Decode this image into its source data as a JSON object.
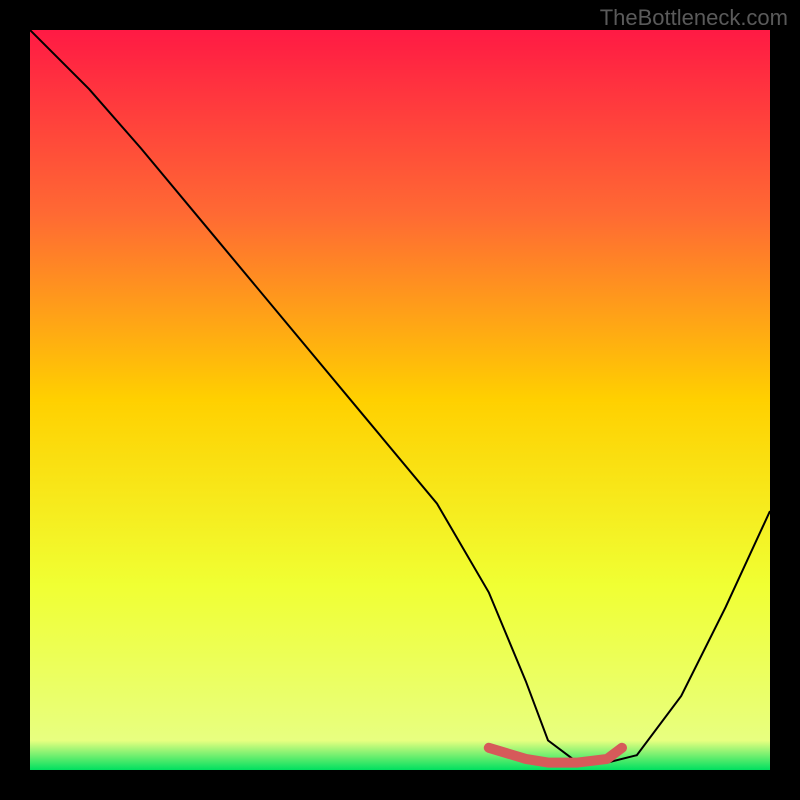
{
  "watermark": "TheBottleneck.com",
  "chart_data": {
    "type": "line",
    "title": "",
    "xlabel": "",
    "ylabel": "",
    "xlim": [
      0,
      100
    ],
    "ylim": [
      0,
      100
    ],
    "gradient_stops": [
      {
        "offset": 0,
        "color": "#ff1a44"
      },
      {
        "offset": 25,
        "color": "#ff6a33"
      },
      {
        "offset": 50,
        "color": "#ffd000"
      },
      {
        "offset": 75,
        "color": "#f0ff33"
      },
      {
        "offset": 96,
        "color": "#e8ff80"
      },
      {
        "offset": 100,
        "color": "#00e060"
      }
    ],
    "series": [
      {
        "name": "bottleneck-curve",
        "color": "#000000",
        "x": [
          0,
          3,
          8,
          15,
          25,
          35,
          45,
          55,
          62,
          67,
          70,
          74,
          78,
          82,
          88,
          94,
          100
        ],
        "y": [
          100,
          97,
          92,
          84,
          72,
          60,
          48,
          36,
          24,
          12,
          4,
          1,
          1,
          2,
          10,
          22,
          35
        ]
      }
    ],
    "highlight": {
      "name": "optimal-zone",
      "color": "#d65a5a",
      "x": [
        62,
        67,
        70,
        74,
        78,
        80
      ],
      "y": [
        3,
        1.5,
        1,
        1,
        1.5,
        3
      ]
    }
  }
}
